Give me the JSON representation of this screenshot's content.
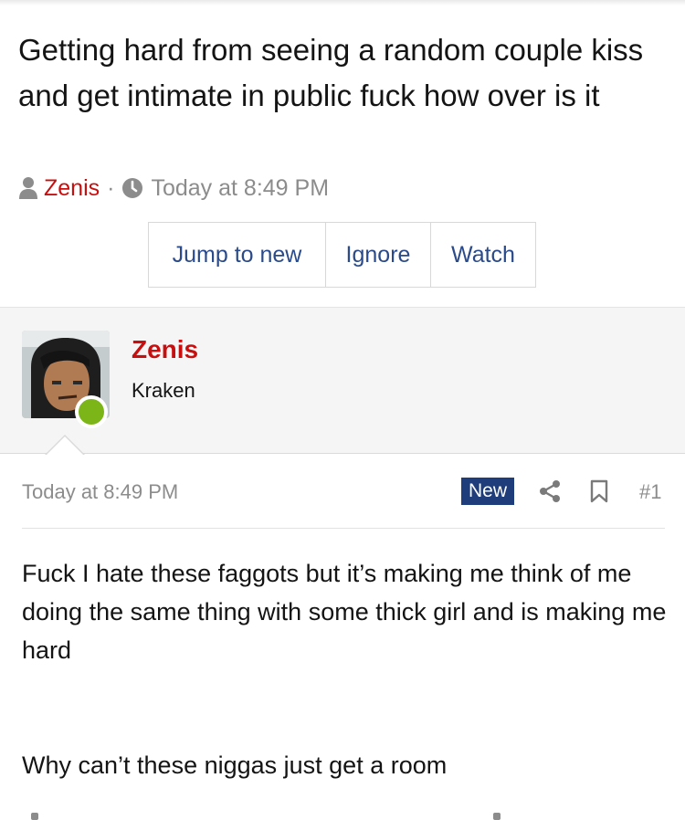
{
  "thread": {
    "title": "Getting hard from seeing a random couple kiss and get intimate in public fuck how over is it",
    "author": "Zenis",
    "separator": "·",
    "timestamp": "Today at 8:49 PM"
  },
  "actions": {
    "jump_label": "Jump to new",
    "ignore_label": "Ignore",
    "watch_label": "Watch"
  },
  "user": {
    "name": "Zenis",
    "title": "Kraken",
    "status": "online"
  },
  "post": {
    "date": "Today at 8:49 PM",
    "badge": "New",
    "number": "#1",
    "body_paragraph_1": "Fuck I hate these faggots but it’s making me think of me doing the same thing with some thick girl and is making me hard",
    "body_paragraph_2": "Why can’t these niggas just get a room"
  },
  "icons": {
    "meta_user": "user-icon",
    "meta_clock": "clock-icon",
    "share": "share-icon",
    "bookmark": "bookmark-icon"
  },
  "colors": {
    "author_red": "#c80f0f",
    "link_blue": "#2a4a8a",
    "badge_blue": "#1f3d7a",
    "online_green": "#7cb518",
    "muted_gray": "#8c8c8c"
  }
}
